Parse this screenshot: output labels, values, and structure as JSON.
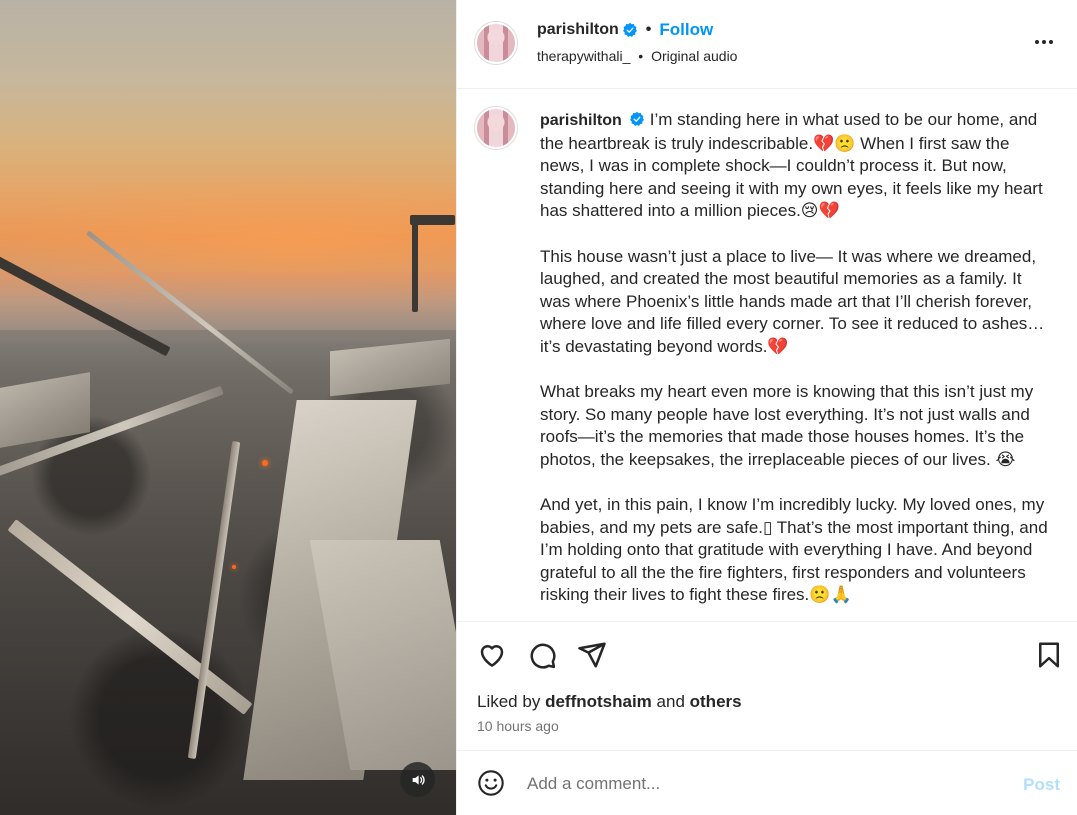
{
  "post": {
    "username": "parishilton",
    "verified_icon": "verified-badge-icon",
    "follow_label": "Follow",
    "separator": "•",
    "audio_user": "therapywithali_",
    "audio_label": "Original audio"
  },
  "caption": {
    "username": "parishilton",
    "paragraphs": [
      "I’m standing here in what used to be our home, and the heartbreak is truly indescribable.💔🙁 When I first saw the news, I was in complete shock—I couldn’t process it. But now, standing here and seeing it with my own eyes, it feels like my heart has shattered into a million pieces.😢💔",
      "This house wasn’t just a place to live— It was where we dreamed, laughed, and created the most beautiful memories as a family. It was where Phoenix’s little hands made art that I’ll cherish forever, where love and life filled every corner. To see it reduced to ashes… it’s devastating beyond words.💔",
      "What breaks my heart even more is knowing that this isn’t just my story. So many people have lost everything. It’s not just walls and roofs—it’s the memories that made those houses homes. It’s the photos, the keepsakes, the irreplaceable pieces of our lives. 😭",
      "And yet, in this pain, I know I’m incredibly lucky. My loved ones, my babies, and my pets are safe.▯ That’s the most important thing, and I’m holding onto that gratitude with everything I have. And beyond grateful to all the the fire fighters, first responders and volunteers risking their lives to fight these fires.🙁🙏"
    ]
  },
  "engagement": {
    "liked_prefix": "Liked by",
    "liked_user": "deffnotshaim",
    "liked_and": "and",
    "liked_others": "others",
    "time_ago": "10 hours ago"
  },
  "comment": {
    "placeholder": "Add a comment...",
    "post_label": "Post"
  },
  "colors": {
    "accent": "#0095f6",
    "post_disabled": "#b2dffc",
    "heart_emoji": "#c6192b"
  }
}
